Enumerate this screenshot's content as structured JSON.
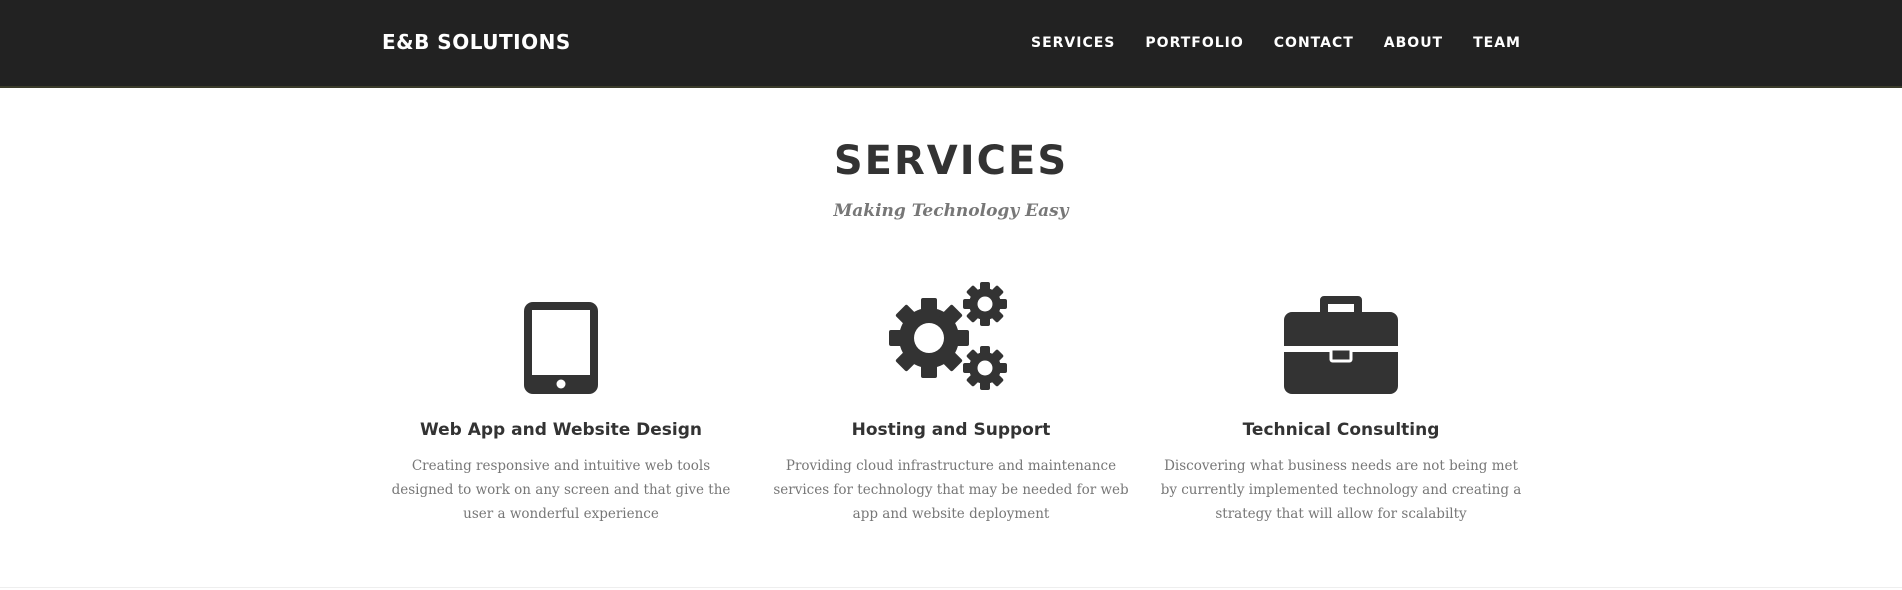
{
  "navbar": {
    "brand": "E&B SOLUTIONS",
    "links": [
      "SERVICES",
      "PORTFOLIO",
      "CONTACT",
      "ABOUT",
      "TEAM"
    ]
  },
  "services_section": {
    "heading": "SERVICES",
    "subheading": "Making Technology Easy",
    "items": [
      {
        "icon": "tablet-icon",
        "title": "Web App and Website Design",
        "description": "Creating responsive and intuitive web tools designed to work on any screen and that give the user a wonderful experience"
      },
      {
        "icon": "gears-icon",
        "title": "Hosting and Support",
        "description": "Providing cloud infrastructure and maintenance services for technology that may be needed for web app and website deployment"
      },
      {
        "icon": "briefcase-icon",
        "title": "Technical Consulting",
        "description": "Discovering what business needs are not being met by currently implemented technology and creating a strategy that will allow for scalabilty"
      }
    ]
  },
  "colors": {
    "navbar_bg": "#222222",
    "heading_text": "#333333",
    "muted_text": "#777777",
    "icon": "#333333"
  }
}
